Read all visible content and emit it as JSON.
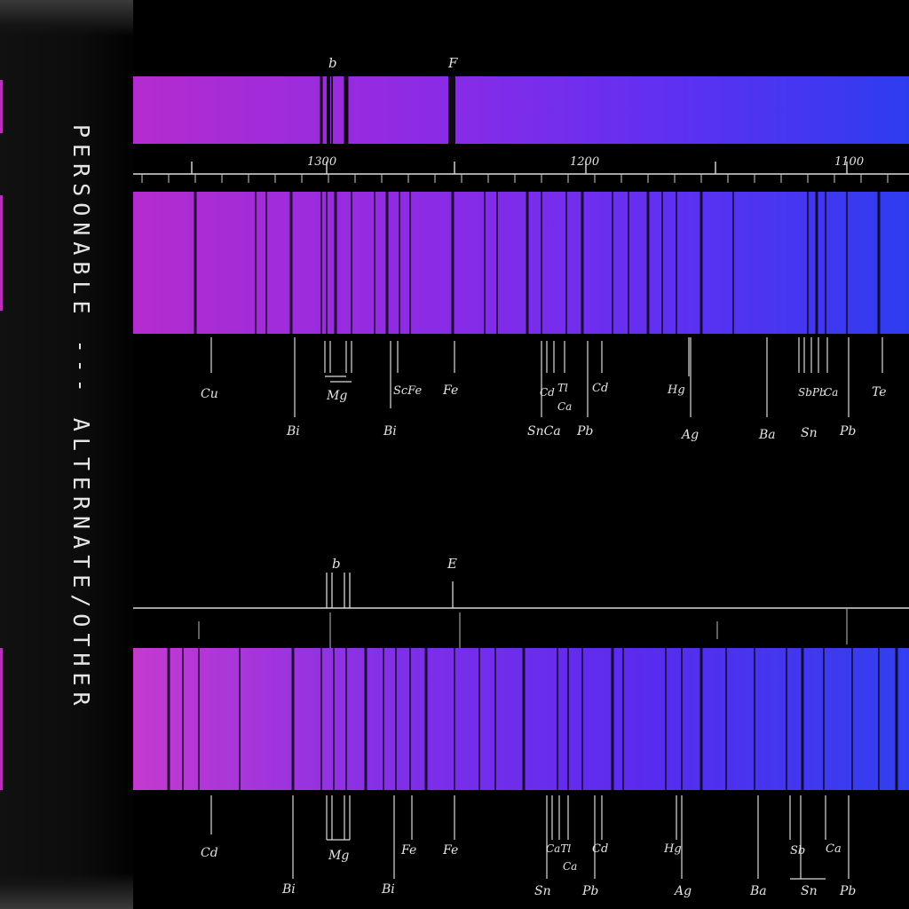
{
  "spine": {
    "title": "PERSONABLE --- ALTERNATE/OTHER",
    "text_color": "#e6e6e6",
    "accent_color": "#c02bbf"
  },
  "plate_top": {
    "markers": [
      "b",
      "F"
    ],
    "scale_labels": [
      "1300",
      "1200",
      "1100"
    ],
    "labels_row1": [
      "Cu",
      "Mg",
      "ScFe",
      "Fe",
      "Cd",
      "Tl",
      "Cd",
      "Hg",
      "SbPb",
      "Ca",
      "Te"
    ],
    "labels_row2": [
      "Bi",
      "Bi",
      "SnCa",
      "Ca",
      "Pb",
      "Ag",
      "Ba",
      "Sn",
      "Pb"
    ]
  },
  "plate_bottom": {
    "markers": [
      "b",
      "E"
    ],
    "labels_row1": [
      "Cd",
      "Mg",
      "Fe",
      "Fe",
      "CaTl",
      "Cd",
      "Hg",
      "Sb",
      "Ca"
    ],
    "labels_row2": [
      "Bi",
      "Bi",
      "Ca",
      "Sn",
      "Pb",
      "Ag",
      "Ba",
      "Sn",
      "Pb"
    ]
  },
  "colors": {
    "spectrum_start": "#b42ccf",
    "spectrum_mid": "#7a2df0",
    "spectrum_end": "#2e3cf0",
    "background": "#000000"
  }
}
